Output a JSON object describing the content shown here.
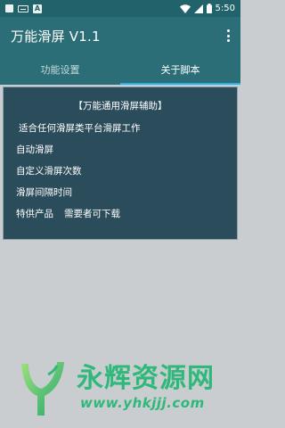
{
  "status_bar": {
    "time": "5:50",
    "letter_icon": "A"
  },
  "app_bar": {
    "title": "万能滑屏 V1.1"
  },
  "tabs": [
    {
      "label": "功能设置",
      "active": false
    },
    {
      "label": "关于脚本",
      "active": true
    }
  ],
  "about": {
    "title": "【万能通用滑屏辅助】",
    "lines": [
      "适合任何滑屏类平台滑屏工作",
      "自动滑屏",
      "自定义滑屏次数",
      "滑屏间隔时间"
    ],
    "footer_left": "特供产品",
    "footer_right": "需要者可下载"
  },
  "watermark": {
    "title": "永辉资源网",
    "url": "www.yhkjjj.com"
  },
  "colors": {
    "status_bar": "#22626a",
    "app_bar": "#2c6e77",
    "tab_indicator": "#23b4ec",
    "card_background": "#2b4c5a",
    "page_background": "#c9cdd0",
    "watermark_green": "#2fb87a"
  },
  "icons": [
    "square-notification-icon",
    "keyboard-icon",
    "letter-a-icon",
    "wifi-icon",
    "signal-icon",
    "battery-icon",
    "overflow-menu-icon"
  ]
}
